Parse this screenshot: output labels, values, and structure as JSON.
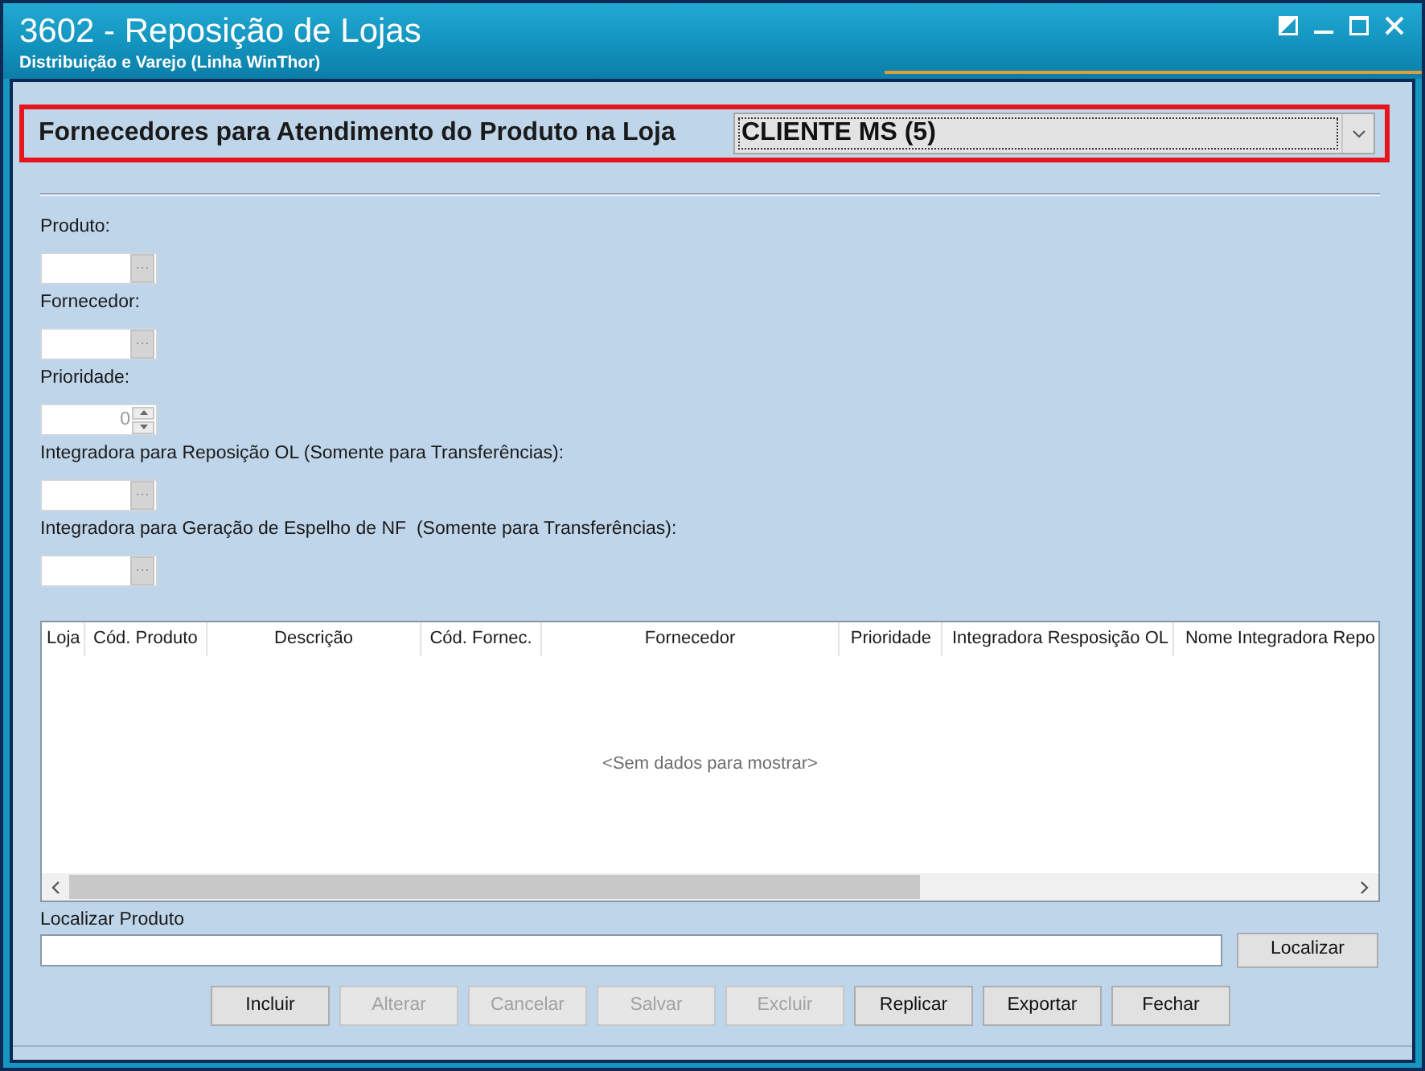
{
  "window": {
    "title": "3602 - Reposição de Lojas",
    "subtitle": "Distribuição e Varejo (Linha WinThor)"
  },
  "store_selector": {
    "label": "Fornecedores para Atendimento do Produto na Loja",
    "value": "CLIENTE MS (5)"
  },
  "fields": [
    {
      "kind": "lookup",
      "label": "Produto:",
      "disabled": true
    },
    {
      "kind": "lookup",
      "label": "Fornecedor:",
      "disabled": true
    },
    {
      "kind": "spinner",
      "label": "Prioridade:",
      "value": "0",
      "disabled": true
    },
    {
      "kind": "lookup",
      "label": "Integradora para Reposição OL (Somente para Transferências):",
      "disabled": true
    },
    {
      "kind": "lookup",
      "label": "Integradora para Geração de Espelho de NF  (Somente para Transferências):",
      "disabled": true
    }
  ],
  "table": {
    "columns": [
      "Loja",
      "Cód. Produto",
      "Descrição",
      "Cód. Fornec.",
      "Fornecedor",
      "Prioridade",
      "Integradora Resposição OL",
      "Nome Integradora Repo"
    ],
    "empty_message": "<Sem dados para mostrar>"
  },
  "search": {
    "label": "Localizar Produto",
    "button": "Localizar"
  },
  "buttons": [
    {
      "label": "Incluir",
      "disabled": false
    },
    {
      "label": "Alterar",
      "disabled": true
    },
    {
      "label": "Cancelar",
      "disabled": true
    },
    {
      "label": "Salvar",
      "disabled": true
    },
    {
      "label": "Excluir",
      "disabled": true
    },
    {
      "label": "Replicar",
      "disabled": false
    },
    {
      "label": "Exportar",
      "disabled": false
    },
    {
      "label": "Fechar",
      "disabled": false
    }
  ]
}
